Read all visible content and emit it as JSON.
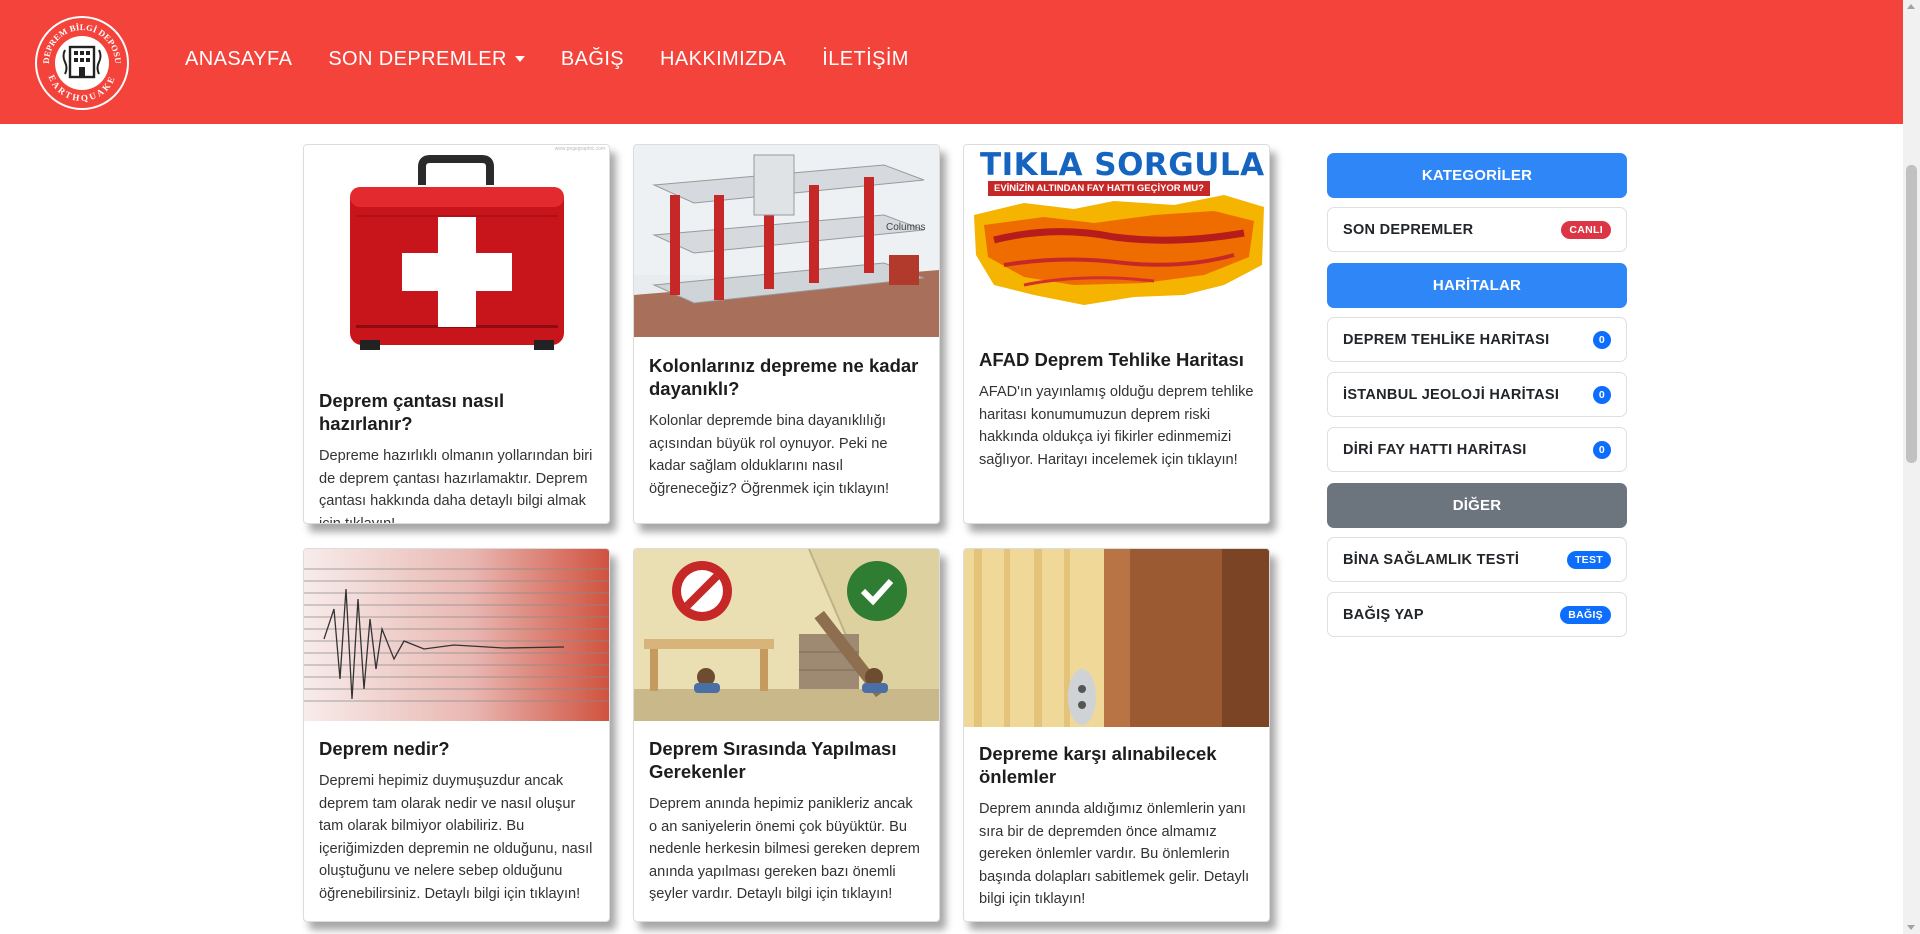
{
  "brand": {
    "logo_text_top": "DEPREM BİLGİ DEPOSU",
    "logo_text_bottom": "EARTHQUAKE",
    "color": "#f4433b"
  },
  "nav": {
    "items": [
      {
        "label": "ANASAYFA"
      },
      {
        "label": "SON DEPREMLER"
      },
      {
        "label": "BAĞIŞ"
      },
      {
        "label": "HAKKIMIZDA"
      },
      {
        "label": "İLETİŞİM"
      }
    ]
  },
  "cards": [
    {
      "title": "Deprem çantası nasıl hazırlanır?",
      "text": "Depreme hazırlıklı olmanın yollarından biri de deprem çantası hazırlamaktır. Deprem çantası hakkında daha detaylı bilgi almak için tıklayın!",
      "image": "first-aid-kit",
      "watermark": "www.pngegraphic.com"
    },
    {
      "title": "Kolonlarınız depreme ne kadar dayanıklı?",
      "text": "Kolonlar depremde bina dayanıklılığı açısından büyük rol oynuyor. Peki ne kadar sağlam olduklarını nasıl öğreneceğiz? Öğrenmek için tıklayın!",
      "image": "building-columns",
      "image_label": "Columns"
    },
    {
      "title": "AFAD Deprem Tehlike Haritası",
      "text": "AFAD'ın yayınlamış olduğu deprem tehlike haritası konumumuzun deprem riski hakkında oldukça iyi fikirler edinmemizi sağlıyor. Haritayı incelemek için tıklayın!",
      "image": "hazard-map",
      "image_title": "TIKLA SORGULA",
      "image_subtitle": "EVİNİZİN ALTINDAN FAY HATTI GEÇİYOR MU?"
    },
    {
      "title": "Deprem nedir?",
      "text": "Depremi hepimiz duymuşuzdur ancak deprem tam olarak nedir ve nasıl oluşur tam olarak bilmiyor olabiliriz. Bu içeriğimizden depremin ne olduğunu, nasıl oluştuğunu ve nelere sebep olduğunu öğrenebilirsiniz. Detaylı bilgi için tıklayın!",
      "image": "seismogram"
    },
    {
      "title": "Deprem Sırasında Yapılması Gerekenler",
      "text": "Deprem anında hepimiz panikleriz ancak o an saniyelerin önemi çok büyüktür. Bu nedenle herkesin bilmesi gereken deprem anında yapılması gereken bazı önemli şeyler vardır. Detaylı bilgi için tıklayın!",
      "image": "drop-cover"
    },
    {
      "title": "Depreme karşı alınabilecek önlemler",
      "text": "Deprem anında aldığımız önlemlerin yanı sıra bir de depremden önce almamız gereken önlemler vardır. Bu önlemlerin başında dolapları sabitlemek gelir. Detaylı bilgi için tıklayın!",
      "image": "wall-anchor"
    }
  ],
  "sidebar": {
    "categories_header": "KATEGORİLER",
    "maps_header": "HARİTALAR",
    "other_header": "DİĞER",
    "items": [
      {
        "label": "SON DEPREMLER",
        "badge": "CANLI",
        "badge_color": "#dc3545"
      },
      {
        "label": "DEPREM TEHLİKE HARİTASI",
        "badge": "0",
        "badge_color": "#0d6efd"
      },
      {
        "label": "İSTANBUL JEOLOJİ HARİTASI",
        "badge": "0",
        "badge_color": "#0d6efd"
      },
      {
        "label": "DİRİ FAY HATTI HARİTASI",
        "badge": "0",
        "badge_color": "#0d6efd"
      },
      {
        "label": "BİNA SAĞLAMLIK TESTİ",
        "badge": "TEST",
        "badge_color": "#0d6efd"
      },
      {
        "label": "BAĞIŞ YAP",
        "badge": "BAĞIŞ",
        "badge_color": "#0d6efd"
      }
    ],
    "header_color_primary": "#2f86f6",
    "header_color_secondary": "#6c757d"
  }
}
